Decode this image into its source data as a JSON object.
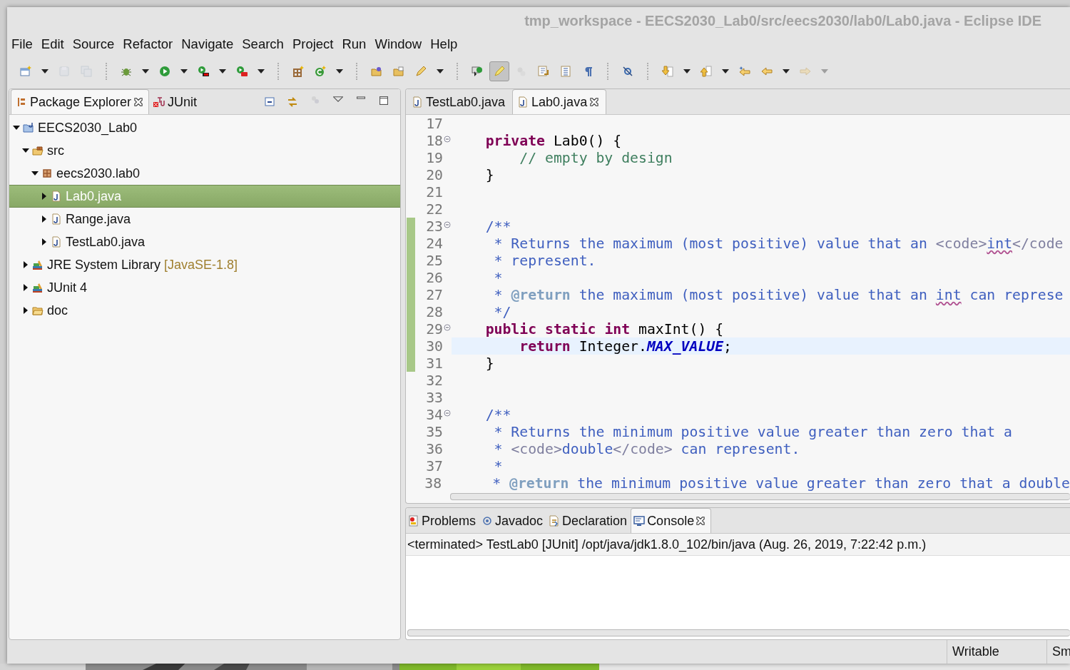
{
  "window": {
    "title": "tmp_workspace - EECS2030_Lab0/src/eecs2030/lab0/Lab0.java - Eclipse IDE"
  },
  "menu": [
    {
      "label": "File"
    },
    {
      "label": "Edit"
    },
    {
      "label": "Source"
    },
    {
      "label": "Refactor"
    },
    {
      "label": "Navigate"
    },
    {
      "label": "Search"
    },
    {
      "label": "Project"
    },
    {
      "label": "Run"
    },
    {
      "label": "Window"
    },
    {
      "label": "Help"
    }
  ],
  "toolbar": [
    {
      "kind": "button",
      "disabled": false,
      "pressed": false
    },
    {
      "kind": "dropdown",
      "disabled": false
    },
    {
      "kind": "button",
      "disabled": true,
      "pressed": false
    },
    {
      "kind": "button",
      "disabled": true,
      "pressed": false
    },
    {
      "kind": "separator"
    },
    {
      "kind": "button",
      "disabled": false,
      "pressed": false
    },
    {
      "kind": "dropdown",
      "disabled": false
    },
    {
      "kind": "button",
      "disabled": false,
      "pressed": false
    },
    {
      "kind": "dropdown",
      "disabled": false
    },
    {
      "kind": "button",
      "disabled": false,
      "pressed": false
    },
    {
      "kind": "dropdown",
      "disabled": false
    },
    {
      "kind": "button",
      "disabled": false,
      "pressed": false
    },
    {
      "kind": "dropdown",
      "disabled": false
    },
    {
      "kind": "separator"
    },
    {
      "kind": "button",
      "disabled": false,
      "pressed": false
    },
    {
      "kind": "button",
      "disabled": false,
      "pressed": false
    },
    {
      "kind": "dropdown",
      "disabled": false
    },
    {
      "kind": "separator"
    },
    {
      "kind": "button",
      "disabled": false,
      "pressed": false
    },
    {
      "kind": "button",
      "disabled": false,
      "pressed": false
    },
    {
      "kind": "button",
      "disabled": false,
      "pressed": false
    },
    {
      "kind": "dropdown",
      "disabled": false
    },
    {
      "kind": "separator"
    },
    {
      "kind": "button",
      "disabled": false,
      "pressed": false
    },
    {
      "kind": "button",
      "disabled": false,
      "pressed": true
    },
    {
      "kind": "button",
      "disabled": true,
      "pressed": false
    },
    {
      "kind": "button",
      "disabled": false,
      "pressed": false
    },
    {
      "kind": "button",
      "disabled": false,
      "pressed": false
    },
    {
      "kind": "button",
      "disabled": false,
      "pressed": false
    },
    {
      "kind": "separator"
    },
    {
      "kind": "button",
      "disabled": false,
      "pressed": false
    },
    {
      "kind": "separator"
    },
    {
      "kind": "button",
      "disabled": false,
      "pressed": false
    },
    {
      "kind": "dropdown",
      "disabled": false
    },
    {
      "kind": "button",
      "disabled": false,
      "pressed": false
    },
    {
      "kind": "dropdown",
      "disabled": false
    },
    {
      "kind": "button",
      "disabled": false,
      "pressed": false
    },
    {
      "kind": "button",
      "disabled": false,
      "pressed": false
    },
    {
      "kind": "dropdown",
      "disabled": false
    },
    {
      "kind": "button",
      "disabled": true,
      "pressed": false
    },
    {
      "kind": "dropdown",
      "disabled": true
    }
  ],
  "package_explorer": {
    "tabs": [
      {
        "label": "Package Explorer",
        "kind": "package-explorer",
        "selected": true,
        "closable": true
      },
      {
        "label": "JUnit",
        "kind": "junit",
        "selected": false,
        "closable": false
      }
    ],
    "view_actions": [
      {
        "disabled": false
      },
      {
        "disabled": false
      },
      {
        "disabled": true
      },
      {
        "disabled": false
      },
      {
        "disabled": false
      },
      {
        "disabled": false
      }
    ],
    "tree": [
      {
        "label": "EECS2030_Lab0",
        "kind": "project",
        "expanded": true,
        "selected": false,
        "children": [
          {
            "label": "src",
            "kind": "source-folder",
            "expanded": true,
            "selected": false,
            "children": [
              {
                "label": "eecs2030.lab0",
                "kind": "package",
                "expanded": true,
                "selected": false,
                "children": [
                  {
                    "label": "Lab0.java",
                    "kind": "java-file",
                    "expanded": false,
                    "selected": true
                  },
                  {
                    "label": "Range.java",
                    "kind": "java-file",
                    "expanded": false,
                    "selected": false
                  },
                  {
                    "label": "TestLab0.java",
                    "kind": "java-file",
                    "expanded": false,
                    "selected": false
                  }
                ]
              }
            ]
          },
          {
            "label": "JRE System Library",
            "decoration": "[JavaSE-1.8]",
            "kind": "library",
            "expanded": false,
            "selected": false
          },
          {
            "label": "JUnit 4",
            "kind": "library",
            "expanded": false,
            "selected": false
          },
          {
            "label": "doc",
            "kind": "folder",
            "expanded": false,
            "selected": false
          }
        ]
      }
    ]
  },
  "editor": {
    "tabs": [
      {
        "label": "TestLab0.java",
        "kind": "java-file",
        "selected": false,
        "closable": false
      },
      {
        "label": "Lab0.java",
        "kind": "java-file",
        "selected": true,
        "closable": true
      }
    ],
    "lines": [
      {
        "number": "17",
        "collapsible": false,
        "changed": false,
        "current": false
      },
      {
        "number": "18",
        "collapsible": true,
        "changed": false,
        "current": false,
        "tokens": [
          {
            "kind": "keyword",
            "text": "    private"
          },
          {
            "kind": "text",
            "text": " Lab0() {"
          }
        ]
      },
      {
        "number": "19",
        "collapsible": false,
        "changed": false,
        "current": false,
        "tokens": [
          {
            "kind": "comment",
            "text": "        // empty by design"
          }
        ]
      },
      {
        "number": "20",
        "collapsible": false,
        "changed": false,
        "current": false,
        "tokens": [
          {
            "kind": "text",
            "text": "    }"
          }
        ]
      },
      {
        "number": "21",
        "collapsible": false,
        "changed": false,
        "current": false
      },
      {
        "number": "22",
        "collapsible": false,
        "changed": false,
        "current": false
      },
      {
        "number": "23",
        "collapsible": true,
        "changed": true,
        "current": false,
        "tokens": [
          {
            "kind": "javadoc",
            "text": "    /**"
          }
        ]
      },
      {
        "number": "24",
        "collapsible": false,
        "changed": true,
        "current": false,
        "tokens": [
          {
            "kind": "javadoc",
            "text": "     * Returns the maximum (most positive) value that an "
          },
          {
            "kind": "html",
            "text": "<code>"
          },
          {
            "kind": "misspelled",
            "text": "int"
          },
          {
            "kind": "html",
            "text": "</code"
          }
        ]
      },
      {
        "number": "25",
        "collapsible": false,
        "changed": true,
        "current": false,
        "tokens": [
          {
            "kind": "javadoc",
            "text": "     * represent."
          }
        ]
      },
      {
        "number": "26",
        "collapsible": false,
        "changed": true,
        "current": false,
        "tokens": [
          {
            "kind": "javadoc",
            "text": "     *"
          }
        ]
      },
      {
        "number": "27",
        "collapsible": false,
        "changed": true,
        "current": false,
        "tokens": [
          {
            "kind": "javadoc",
            "text": "     * "
          },
          {
            "kind": "doctag",
            "text": "@return"
          },
          {
            "kind": "javadoc",
            "text": " the maximum (most positive) value that an "
          },
          {
            "kind": "misspelled",
            "text": "int"
          },
          {
            "kind": "javadoc",
            "text": " can represe"
          }
        ]
      },
      {
        "number": "28",
        "collapsible": false,
        "changed": true,
        "current": false,
        "tokens": [
          {
            "kind": "javadoc",
            "text": "     */"
          }
        ]
      },
      {
        "number": "29",
        "collapsible": true,
        "changed": true,
        "current": false,
        "tokens": [
          {
            "kind": "keyword",
            "text": "    public "
          },
          {
            "kind": "keyword",
            "text": "static "
          },
          {
            "kind": "keyword",
            "text": "int"
          },
          {
            "kind": "text",
            "text": " maxInt() {"
          }
        ]
      },
      {
        "number": "30",
        "collapsible": false,
        "changed": true,
        "current": true,
        "tokens": [
          {
            "kind": "keyword",
            "text": "        return"
          },
          {
            "kind": "text",
            "text": " Integer."
          },
          {
            "kind": "field",
            "text": "MAX_VALUE"
          },
          {
            "kind": "text",
            "text": ";"
          }
        ]
      },
      {
        "number": "31",
        "collapsible": false,
        "changed": true,
        "current": false,
        "tokens": [
          {
            "kind": "text",
            "text": "    }"
          }
        ]
      },
      {
        "number": "32",
        "collapsible": false,
        "changed": false,
        "current": false
      },
      {
        "number": "33",
        "collapsible": false,
        "changed": false,
        "current": false
      },
      {
        "number": "34",
        "collapsible": true,
        "changed": false,
        "current": false,
        "tokens": [
          {
            "kind": "javadoc",
            "text": "    /**"
          }
        ]
      },
      {
        "number": "35",
        "collapsible": false,
        "changed": false,
        "current": false,
        "tokens": [
          {
            "kind": "javadoc",
            "text": "     * Returns the minimum positive value greater than zero that a"
          }
        ]
      },
      {
        "number": "36",
        "collapsible": false,
        "changed": false,
        "current": false,
        "tokens": [
          {
            "kind": "javadoc",
            "text": "     * "
          },
          {
            "kind": "html",
            "text": "<code>"
          },
          {
            "kind": "javadoc",
            "text": "double"
          },
          {
            "kind": "html",
            "text": "</code>"
          },
          {
            "kind": "javadoc",
            "text": " can represent."
          }
        ]
      },
      {
        "number": "37",
        "collapsible": false,
        "changed": false,
        "current": false,
        "tokens": [
          {
            "kind": "javadoc",
            "text": "     *"
          }
        ]
      },
      {
        "number": "38",
        "collapsible": false,
        "changed": false,
        "current": false,
        "tokens": [
          {
            "kind": "javadoc",
            "text": "     * "
          },
          {
            "kind": "doctag",
            "text": "@return"
          },
          {
            "kind": "javadoc",
            "text": " the minimum positive value greater than zero that a double"
          }
        ]
      }
    ]
  },
  "console": {
    "tabs": [
      {
        "label": "Problems",
        "kind": "problems",
        "selected": false,
        "closable": false
      },
      {
        "label": "Javadoc",
        "kind": "javadoc",
        "selected": false,
        "closable": false
      },
      {
        "label": "Declaration",
        "kind": "declaration",
        "selected": false,
        "closable": false
      },
      {
        "label": "Console",
        "kind": "console",
        "selected": true,
        "closable": true
      }
    ],
    "header": "<terminated> TestLab0 [JUnit] /opt/java/jdk1.8.0_102/bin/java (Aug. 26, 2019, 7:22:42 p.m.)"
  },
  "status_bar": {
    "fields": [
      "Writable",
      "Sm"
    ]
  }
}
